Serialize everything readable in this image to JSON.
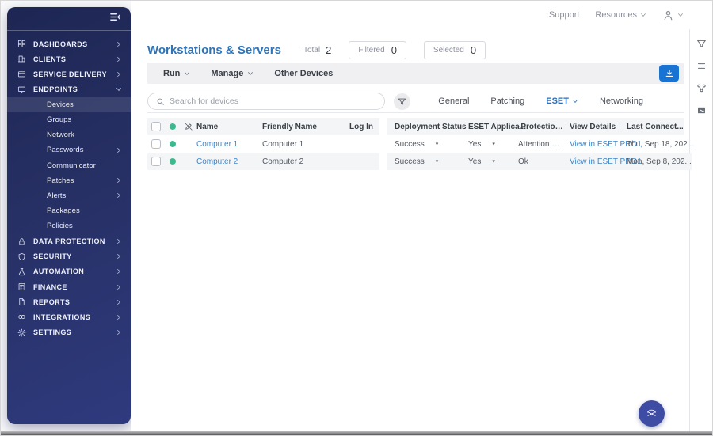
{
  "topbar": {
    "support": "Support",
    "resources": "Resources"
  },
  "sidebar": {
    "items": [
      {
        "label": "DASHBOARDS"
      },
      {
        "label": "CLIENTS"
      },
      {
        "label": "SERVICE DELIVERY"
      },
      {
        "label": "ENDPOINTS"
      },
      {
        "label": "DATA PROTECTION"
      },
      {
        "label": "SECURITY"
      },
      {
        "label": "AUTOMATION"
      },
      {
        "label": "FINANCE"
      },
      {
        "label": "REPORTS"
      },
      {
        "label": "INTEGRATIONS"
      },
      {
        "label": "SETTINGS"
      }
    ],
    "endpoints_children": [
      {
        "label": "Devices"
      },
      {
        "label": "Groups"
      },
      {
        "label": "Network"
      },
      {
        "label": "Passwords"
      },
      {
        "label": "Communicator"
      },
      {
        "label": "Patches"
      },
      {
        "label": "Alerts"
      },
      {
        "label": "Packages"
      },
      {
        "label": "Policies"
      }
    ]
  },
  "page": {
    "title": "Workstations & Servers",
    "counters": {
      "total_label": "Total",
      "total_value": "2",
      "filtered_label": "Filtered",
      "filtered_value": "0",
      "selected_label": "Selected",
      "selected_value": "0"
    }
  },
  "toolbar": {
    "run": "Run",
    "manage": "Manage",
    "other_devices": "Other Devices"
  },
  "search": {
    "placeholder": "Search for devices"
  },
  "tabs": [
    {
      "label": "General"
    },
    {
      "label": "Patching"
    },
    {
      "label": "ESET"
    },
    {
      "label": "Networking"
    }
  ],
  "table": {
    "columns": {
      "name": "Name",
      "friendly": "Friendly Name",
      "login": "Log In",
      "deployment": "Deployment Status",
      "eset_app": "ESET Applica...",
      "protection": "-Protection S...",
      "view": "View Details",
      "last": "Last Connect..."
    },
    "rows": [
      {
        "name": "Computer 1",
        "friendly": "Computer 1",
        "login": "",
        "deployment": "Success",
        "eset_app": "Yes",
        "protection": "Attention Requi...",
        "view": "View in ESET PRO1",
        "last": "Thu, Sep 18, 202..."
      },
      {
        "name": "Computer 2",
        "friendly": "Computer 2",
        "login": "",
        "deployment": "Success",
        "eset_app": "Yes",
        "protection": "Ok",
        "view": "View in ESET PRO1",
        "last": "Mon, Sep 8, 202..."
      }
    ]
  },
  "colors": {
    "title_blue": "#2e74b8",
    "link_blue": "#3d86c8",
    "download_blue": "#1973d2",
    "status_green": "#3cba8e",
    "sidebar_navy": "#273064",
    "fab_indigo": "#3e4da3"
  }
}
